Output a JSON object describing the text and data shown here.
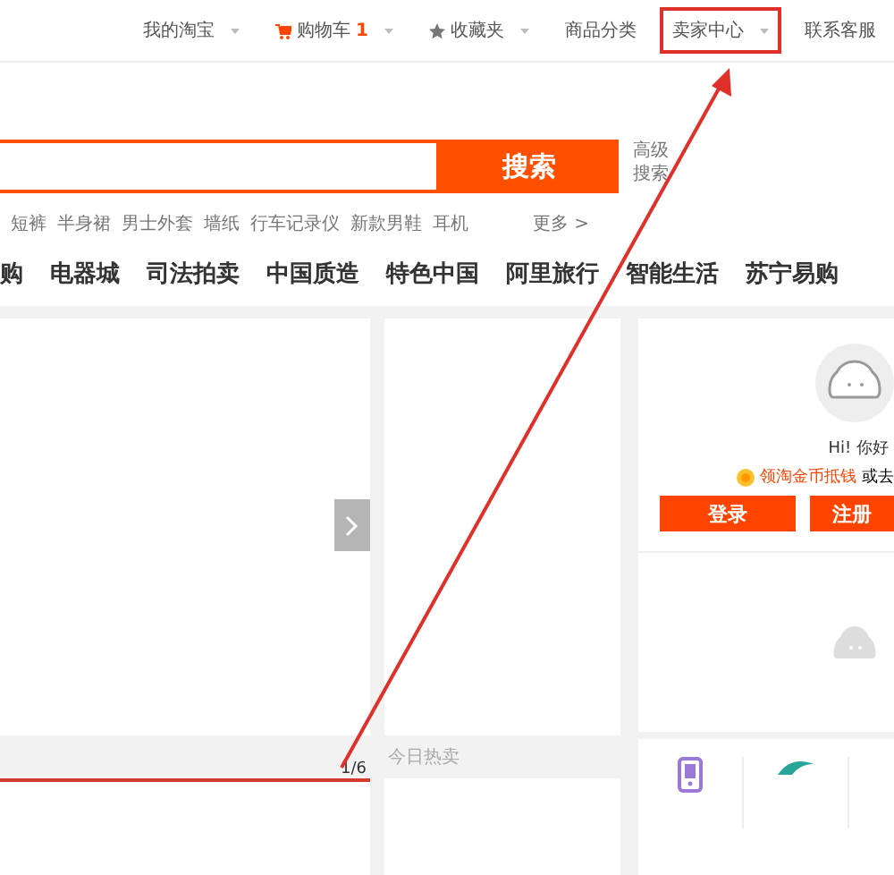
{
  "top_bar": {
    "items": [
      {
        "kind": "text",
        "label": "我的淘宝",
        "dropdown": true,
        "highlighted": false
      },
      {
        "kind": "cart",
        "label": "购物车",
        "count": "1",
        "dropdown": true,
        "highlighted": false
      },
      {
        "kind": "star",
        "label": "收藏夹",
        "dropdown": true,
        "highlighted": false
      },
      {
        "kind": "text",
        "label": "商品分类",
        "dropdown": false,
        "highlighted": false
      },
      {
        "kind": "text",
        "label": "卖家中心",
        "dropdown": true,
        "highlighted": true
      },
      {
        "kind": "text",
        "label": "联系客服",
        "dropdown": false,
        "highlighted": false
      }
    ]
  },
  "search": {
    "button": "搜索",
    "advanced": [
      "高级",
      "搜索"
    ]
  },
  "hot_words": [
    "短裤",
    "半身裙",
    "男士外套",
    "墙纸",
    "行车记录仪",
    "新款男鞋",
    "耳机"
  ],
  "more": "更多 >",
  "nav": [
    "购",
    "电器城",
    "司法拍卖",
    "中国质造",
    "特色中国",
    "阿里旅行",
    "智能生活",
    "苏宁易购"
  ],
  "carousel": {
    "page": "1/6"
  },
  "today": {
    "title": "今日热卖"
  },
  "user_panel": {
    "greeting": "Hi! 你好",
    "coin_link": "领淘金币抵钱",
    "or_text": "或去",
    "buttons": [
      "登录",
      "注册"
    ]
  },
  "annotation": {
    "arrow": true
  }
}
